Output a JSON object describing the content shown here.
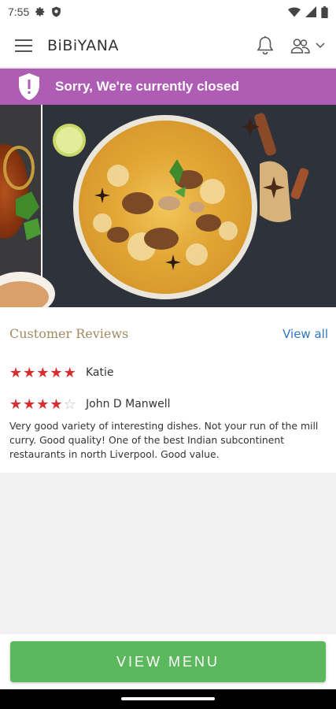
{
  "status_bar": {
    "time": "7:55"
  },
  "app_bar": {
    "brand": "BiBiYANA"
  },
  "banner": {
    "text": "Sorry, We're currently closed",
    "color": "#ae5cb4"
  },
  "reviews": {
    "title": "Customer Reviews",
    "view_all": "View all",
    "items": [
      {
        "name": "Katie",
        "rating": 5,
        "text": ""
      },
      {
        "name": "John D Manwell",
        "rating": 4,
        "text": "Very good variety of interesting dishes. Not your run of the mill curry. Good quality! One of the best Indian subcontinent restaurants in north Liverpool. Good value."
      }
    ]
  },
  "cta": {
    "label": "VIEW MENU",
    "color": "#5cb85c"
  },
  "icons": [
    "settings-icon",
    "shield-status-icon",
    "wifi-icon",
    "signal-icon",
    "battery-icon",
    "hamburger-menu-icon",
    "bell-icon",
    "user-group-icon",
    "chevron-down-icon",
    "shield-closed-icon"
  ]
}
